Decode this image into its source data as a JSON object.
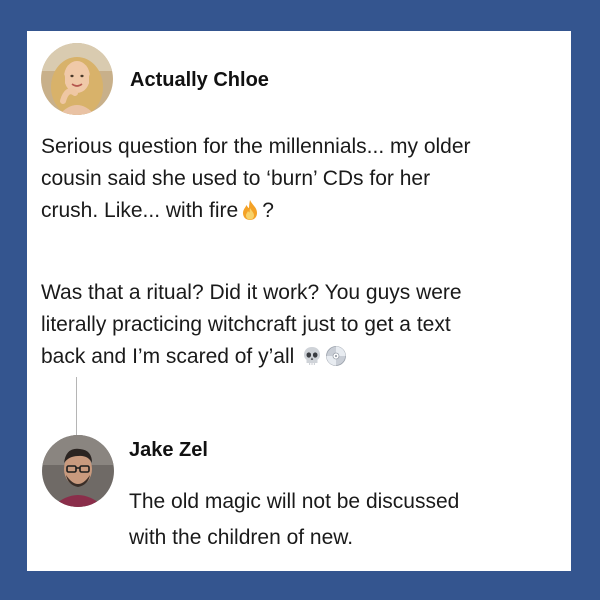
{
  "post": {
    "author": "Actually Chloe",
    "paragraph1": {
      "line1": "Serious question for the millennials... my older",
      "line2": "cousin said she used to ‘burn’ CDs for her",
      "line3_before_emoji": "crush. Like... with fire",
      "line3_after_emoji": "?"
    },
    "paragraph2": {
      "line1": "Was that a ritual? Did it work? You guys were",
      "line2": "literally practicing witchcraft just to get a text",
      "line3": "back and I’m scared of y’all"
    },
    "emojis": [
      "fire-icon",
      "skull-icon",
      "cd-icon"
    ]
  },
  "reply": {
    "author": "Jake Zel",
    "line1": "The old magic will not be discussed",
    "line2": "with the children of new."
  },
  "colors": {
    "frame": "#34558f",
    "card": "#ffffff",
    "text": "#1a1a1a"
  }
}
